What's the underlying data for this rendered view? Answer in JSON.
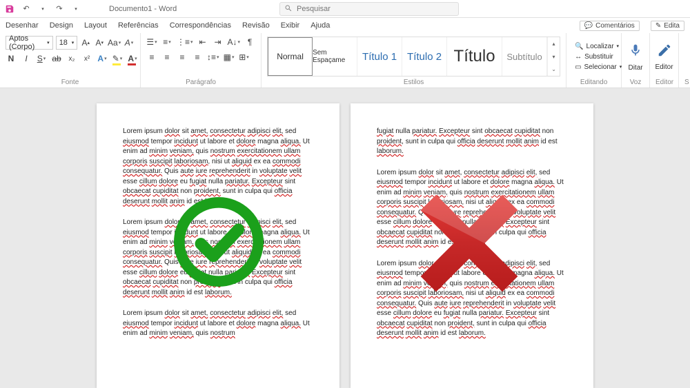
{
  "title": "Documento1 - Word",
  "search_placeholder": "Pesquisar",
  "tabs": [
    "Desenhar",
    "Design",
    "Layout",
    "Referências",
    "Correspondências",
    "Revisão",
    "Exibir",
    "Ajuda"
  ],
  "right_buttons": {
    "comments": "Comentários",
    "edit": "Edita"
  },
  "font": {
    "name": "Aptos (Corpo)",
    "size": "18",
    "group_label": "Fonte"
  },
  "paragraph": {
    "group_label": "Parágrafo"
  },
  "styles": {
    "group_label": "Estilos",
    "items": [
      "Normal",
      "Sem Espaçame",
      "Título 1",
      "Título 2",
      "Título",
      "Subtítulo"
    ]
  },
  "editing": {
    "group_label": "Editando",
    "find": "Localizar",
    "replace": "Substituir",
    "select": "Selecionar"
  },
  "voice": {
    "label": "Ditar",
    "group_label": "Voz"
  },
  "editor": {
    "label": "Editor",
    "group_label": "Editor"
  },
  "s_label": "S",
  "lorem": "Lorem ipsum dolor sit amet, consectetur adipisci elit, sed eiusmod tempor incidunt ut labore et dolore magna aliqua. Ut enim ad minim veniam, quis nostrum exercitationem ullam corporis suscipit laboriosam, nisi ut aliquid ex ea commodi consequatur. Quis aute iure reprehenderit in voluptate velit esse cillum dolore eu fugiat nulla pariatur. Excepteur sint obcaecat cupiditat non proident, sunt in culpa qui officia deserunt mollit anim id est laborum.",
  "lorem_tail": "fugiat nulla pariatur. Excepteur sint obcaecat cupiditat non proident, sunt in culpa qui officia deserunt mollit anim id est laborum.",
  "lorem_head": "Lorem ipsum dolor sit amet, consectetur adipisci elit, sed eiusmod tempor incidunt ut labore et dolore magna aliqua. Ut enim ad minim veniam, quis nostrum"
}
